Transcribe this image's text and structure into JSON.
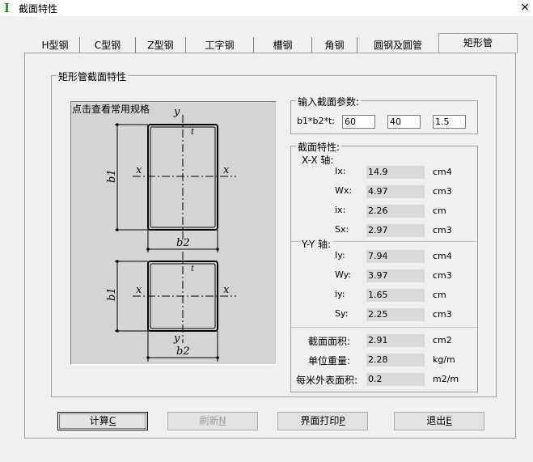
{
  "window": {
    "icon": "I-beam-app-icon",
    "title": "截面特性",
    "close": "×"
  },
  "tabs": [
    {
      "label": "H型钢"
    },
    {
      "label": "C型钢"
    },
    {
      "label": "Z型钢"
    },
    {
      "label": "工字钢"
    },
    {
      "label": "槽钢"
    },
    {
      "label": "角钢"
    },
    {
      "label": "圆钢及圆管"
    },
    {
      "label": "矩形管"
    }
  ],
  "active_tab": "矩形管",
  "section_group": {
    "title": "矩形管截面特性"
  },
  "figure": {
    "hint": "点击查看常用规格",
    "labels": {
      "y": "y",
      "x": "x",
      "t": "t",
      "b1": "b1",
      "b2": "b2"
    }
  },
  "input_group": {
    "title": "输入截面参数:",
    "label": "b1*b2*t:",
    "values": [
      "60",
      "40",
      "1.5"
    ]
  },
  "props_group": {
    "title": "截面特性:",
    "xx_axis": "X-X 轴:",
    "yy_axis": "Y-Y 轴:",
    "xx": [
      {
        "name": "Ix:",
        "value": "14.9",
        "unit": "cm4"
      },
      {
        "name": "Wx:",
        "value": "4.97",
        "unit": "cm3"
      },
      {
        "name": "ix:",
        "value": "2.26",
        "unit": "cm"
      },
      {
        "name": "Sx:",
        "value": "2.97",
        "unit": "cm3"
      }
    ],
    "yy": [
      {
        "name": "Iy:",
        "value": "7.94",
        "unit": "cm4"
      },
      {
        "name": "Wy:",
        "value": "3.97",
        "unit": "cm3"
      },
      {
        "name": "iy:",
        "value": "1.65",
        "unit": "cm"
      },
      {
        "name": "Sy:",
        "value": "2.25",
        "unit": "cm3"
      }
    ],
    "other": [
      {
        "name": "截面面积:",
        "value": "2.91",
        "unit": "cm2"
      },
      {
        "name": "单位重量:",
        "value": "2.28",
        "unit": "kg/m"
      },
      {
        "name": "每米外表面积:",
        "value": "0.2",
        "unit": "m2/m"
      }
    ]
  },
  "buttons": [
    {
      "label": "计算",
      "key": "C",
      "state": "default"
    },
    {
      "label": "刷新",
      "key": "N",
      "state": "disabled"
    },
    {
      "label": "界面打印",
      "key": "P",
      "state": "normal"
    },
    {
      "label": "退出",
      "key": "E",
      "state": "normal"
    }
  ]
}
